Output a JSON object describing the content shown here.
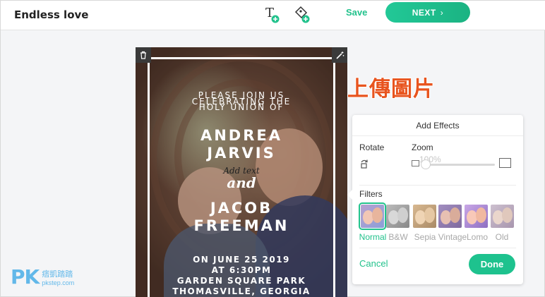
{
  "header": {
    "title": "Endless love",
    "save_label": "Save",
    "next_label": "NEXT",
    "next_chevron": "›"
  },
  "invitation": {
    "line1": "PLEASE JOIN US",
    "line2": "CELEBRATING THE",
    "line3": "HOLY UNION OF",
    "name1a": "ANDREA",
    "name1b": "JARVIS",
    "add_text": "Add text",
    "and": "and",
    "name2a": "JACOB",
    "name2b": "FREEMAN",
    "date": "ON JUNE 25 2019",
    "time": "AT 6:30PM",
    "venue": "GARDEN SQUARE PARK",
    "city": "THOMASVILLE, GEORGIA"
  },
  "overlay_label": "上傳圖片",
  "effects": {
    "title": "Add Effects",
    "rotate_label": "Rotate",
    "zoom_label": "Zoom",
    "zoom_value": "100%",
    "zoom_fraction": 0.0,
    "filters_label": "Filters",
    "filters": [
      {
        "name": "Normal",
        "selected": true
      },
      {
        "name": "B&W",
        "selected": false
      },
      {
        "name": "Sepia",
        "selected": false
      },
      {
        "name": "Vintage",
        "selected": false
      },
      {
        "name": "Lomo",
        "selected": false
      },
      {
        "name": "Old",
        "selected": false
      }
    ],
    "cancel_label": "Cancel",
    "done_label": "Done"
  },
  "watermark": {
    "logo": "PK",
    "cn": "痞凱踏踏",
    "en": "pkstep.com"
  },
  "colors": {
    "accent": "#22c28c",
    "overlay_label": "#e8541e"
  }
}
